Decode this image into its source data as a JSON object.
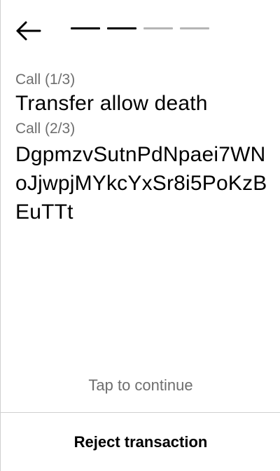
{
  "header": {
    "back_icon": "arrow-left-icon",
    "progress": {
      "completed_steps": 2,
      "total_steps": 4
    }
  },
  "calls": [
    {
      "label": "Call (1/3)",
      "value": "Transfer allow death"
    },
    {
      "label": "Call (2/3)",
      "value": "DgpmzvSutnPdNpaei7WNoJjwpjMYkcYxSr8i5PoKzBEuTTt"
    }
  ],
  "footer": {
    "hint": "Tap to continue",
    "reject_label": "Reject transaction"
  },
  "colors": {
    "text": "#000000",
    "muted_text": "#6e6e6e",
    "progress_complete": "#000000",
    "progress_pending": "#b5b5b5",
    "divider": "#cfcfcf",
    "background": "#ffffff"
  }
}
